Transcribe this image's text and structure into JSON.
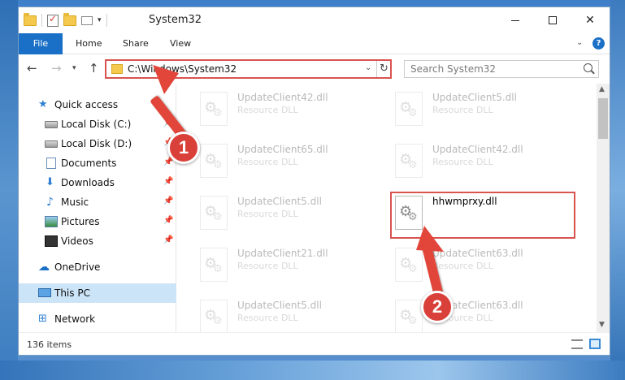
{
  "window": {
    "title": "System32",
    "controls": {
      "minimize": "minimize",
      "maximize": "maximize",
      "close": "✕"
    }
  },
  "ribbon": {
    "tabs": [
      {
        "label": "File"
      },
      {
        "label": "Home"
      },
      {
        "label": "Share"
      },
      {
        "label": "View"
      }
    ],
    "help": "?"
  },
  "address": {
    "path": "C:\\Windows\\System32",
    "refresh": "↻"
  },
  "search": {
    "placeholder": "Search System32"
  },
  "sidebar": {
    "items": [
      {
        "label": "Quick access",
        "icon": "star-icon",
        "pinned": false
      },
      {
        "label": "Local Disk (C:)",
        "icon": "disk-icon",
        "pinned": true
      },
      {
        "label": "Local Disk (D:)",
        "icon": "disk-icon",
        "pinned": true
      },
      {
        "label": "Documents",
        "icon": "document-icon",
        "pinned": true
      },
      {
        "label": "Downloads",
        "icon": "download-icon",
        "pinned": true
      },
      {
        "label": "Music",
        "icon": "music-icon",
        "pinned": true
      },
      {
        "label": "Pictures",
        "icon": "pictures-icon",
        "pinned": true
      },
      {
        "label": "Videos",
        "icon": "videos-icon",
        "pinned": true
      },
      {
        "label": "OneDrive",
        "icon": "onedrive-icon",
        "pinned": false
      },
      {
        "label": "This PC",
        "icon": "pc-icon",
        "pinned": false,
        "selected": true
      },
      {
        "label": "Network",
        "icon": "network-icon",
        "pinned": false
      }
    ]
  },
  "files": [
    {
      "name": "UpdateClient42.dll",
      "type": "Resource DLL",
      "faded": true
    },
    {
      "name": "UpdateClient5.dll",
      "type": "Resource DLL",
      "faded": true
    },
    {
      "name": "UpdateClient65.dll",
      "type": "Resource DLL",
      "faded": true
    },
    {
      "name": "UpdateClient42.dll",
      "type": "Resource DLL",
      "faded": true
    },
    {
      "name": "UpdateClient5.dll",
      "type": "Resource DLL",
      "faded": true
    },
    {
      "name": "hhwmprxy.dll",
      "type": "",
      "faded": false
    },
    {
      "name": "UpdateClient21.dll",
      "type": "Resource DLL",
      "faded": true
    },
    {
      "name": "UpdateClient63.dll",
      "type": "Resource DLL",
      "faded": true
    },
    {
      "name": "UpdateClient5.dll",
      "type": "Resource DLL",
      "faded": true
    },
    {
      "name": "UpdateClient63.dll",
      "type": "Resource DLL",
      "faded": true
    }
  ],
  "status": {
    "item_count": "136 items"
  },
  "annotations": {
    "step1": "1",
    "step2": "2",
    "color": "#e2463a"
  }
}
